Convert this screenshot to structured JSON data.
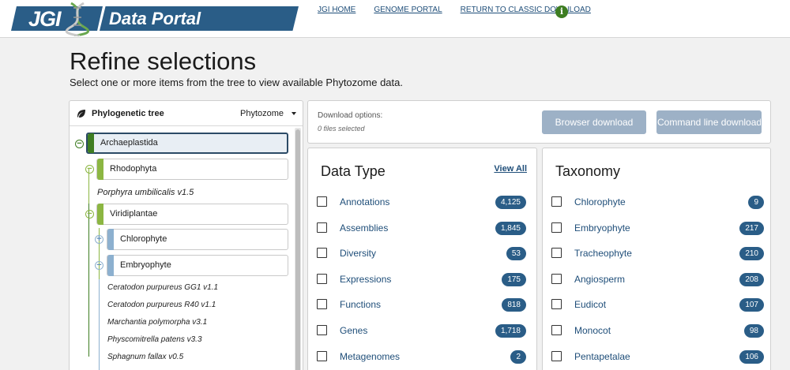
{
  "header": {
    "logo_text": "JGI",
    "portal_text": "Data Portal",
    "links": [
      "JGI HOME",
      "GENOME PORTAL",
      "RETURN TO CLASSIC DOWNLOAD"
    ],
    "info_glyph": "i"
  },
  "page": {
    "title": "Refine selections",
    "subtitle": "Select one or more items from the tree to view available Phytozome data."
  },
  "tree": {
    "title": "Phylogenetic tree",
    "source": "Phytozome",
    "nodes": {
      "archaeplastida": "Archaeplastida",
      "rhodophyta": "Rhodophyta",
      "porphyra": "Porphyra umbilicalis v1.5",
      "viridiplantae": "Viridiplantae",
      "chlorophyte": "Chlorophyte",
      "embryophyte": "Embryophyte"
    },
    "genomes": [
      "Ceratodon purpureus GG1 v1.1",
      "Ceratodon purpureus R40 v1.1",
      "Marchantia polymorpha v3.1",
      "Physcomitrella patens v3.3",
      "Sphagnum fallax v0.5"
    ]
  },
  "download": {
    "label": "Download options:",
    "count": "0 files selected",
    "browser_btn": "Browser download",
    "cmd_btn": "Command line download"
  },
  "data_type": {
    "title": "Data Type",
    "view_all": "View All",
    "items": [
      {
        "label": "Annotations",
        "count": "4,125"
      },
      {
        "label": "Assemblies",
        "count": "1,845"
      },
      {
        "label": "Diversity",
        "count": "53"
      },
      {
        "label": "Expressions",
        "count": "175"
      },
      {
        "label": "Functions",
        "count": "818"
      },
      {
        "label": "Genes",
        "count": "1,718"
      },
      {
        "label": "Metagenomes",
        "count": "2"
      }
    ]
  },
  "taxonomy": {
    "title": "Taxonomy",
    "items": [
      {
        "label": "Chlorophyte",
        "count": "9"
      },
      {
        "label": "Embryophyte",
        "count": "217"
      },
      {
        "label": "Tracheophyte",
        "count": "210"
      },
      {
        "label": "Angiosperm",
        "count": "208"
      },
      {
        "label": "Eudicot",
        "count": "107"
      },
      {
        "label": "Monocot",
        "count": "98"
      },
      {
        "label": "Pentapetalae",
        "count": "106"
      }
    ]
  },
  "colors": {
    "brand_blue": "#2a5d87",
    "dark_green": "#3e7d22",
    "light_green": "#8cb642",
    "light_blue": "#8db0cf",
    "disabled_button": "#9db1c6"
  }
}
